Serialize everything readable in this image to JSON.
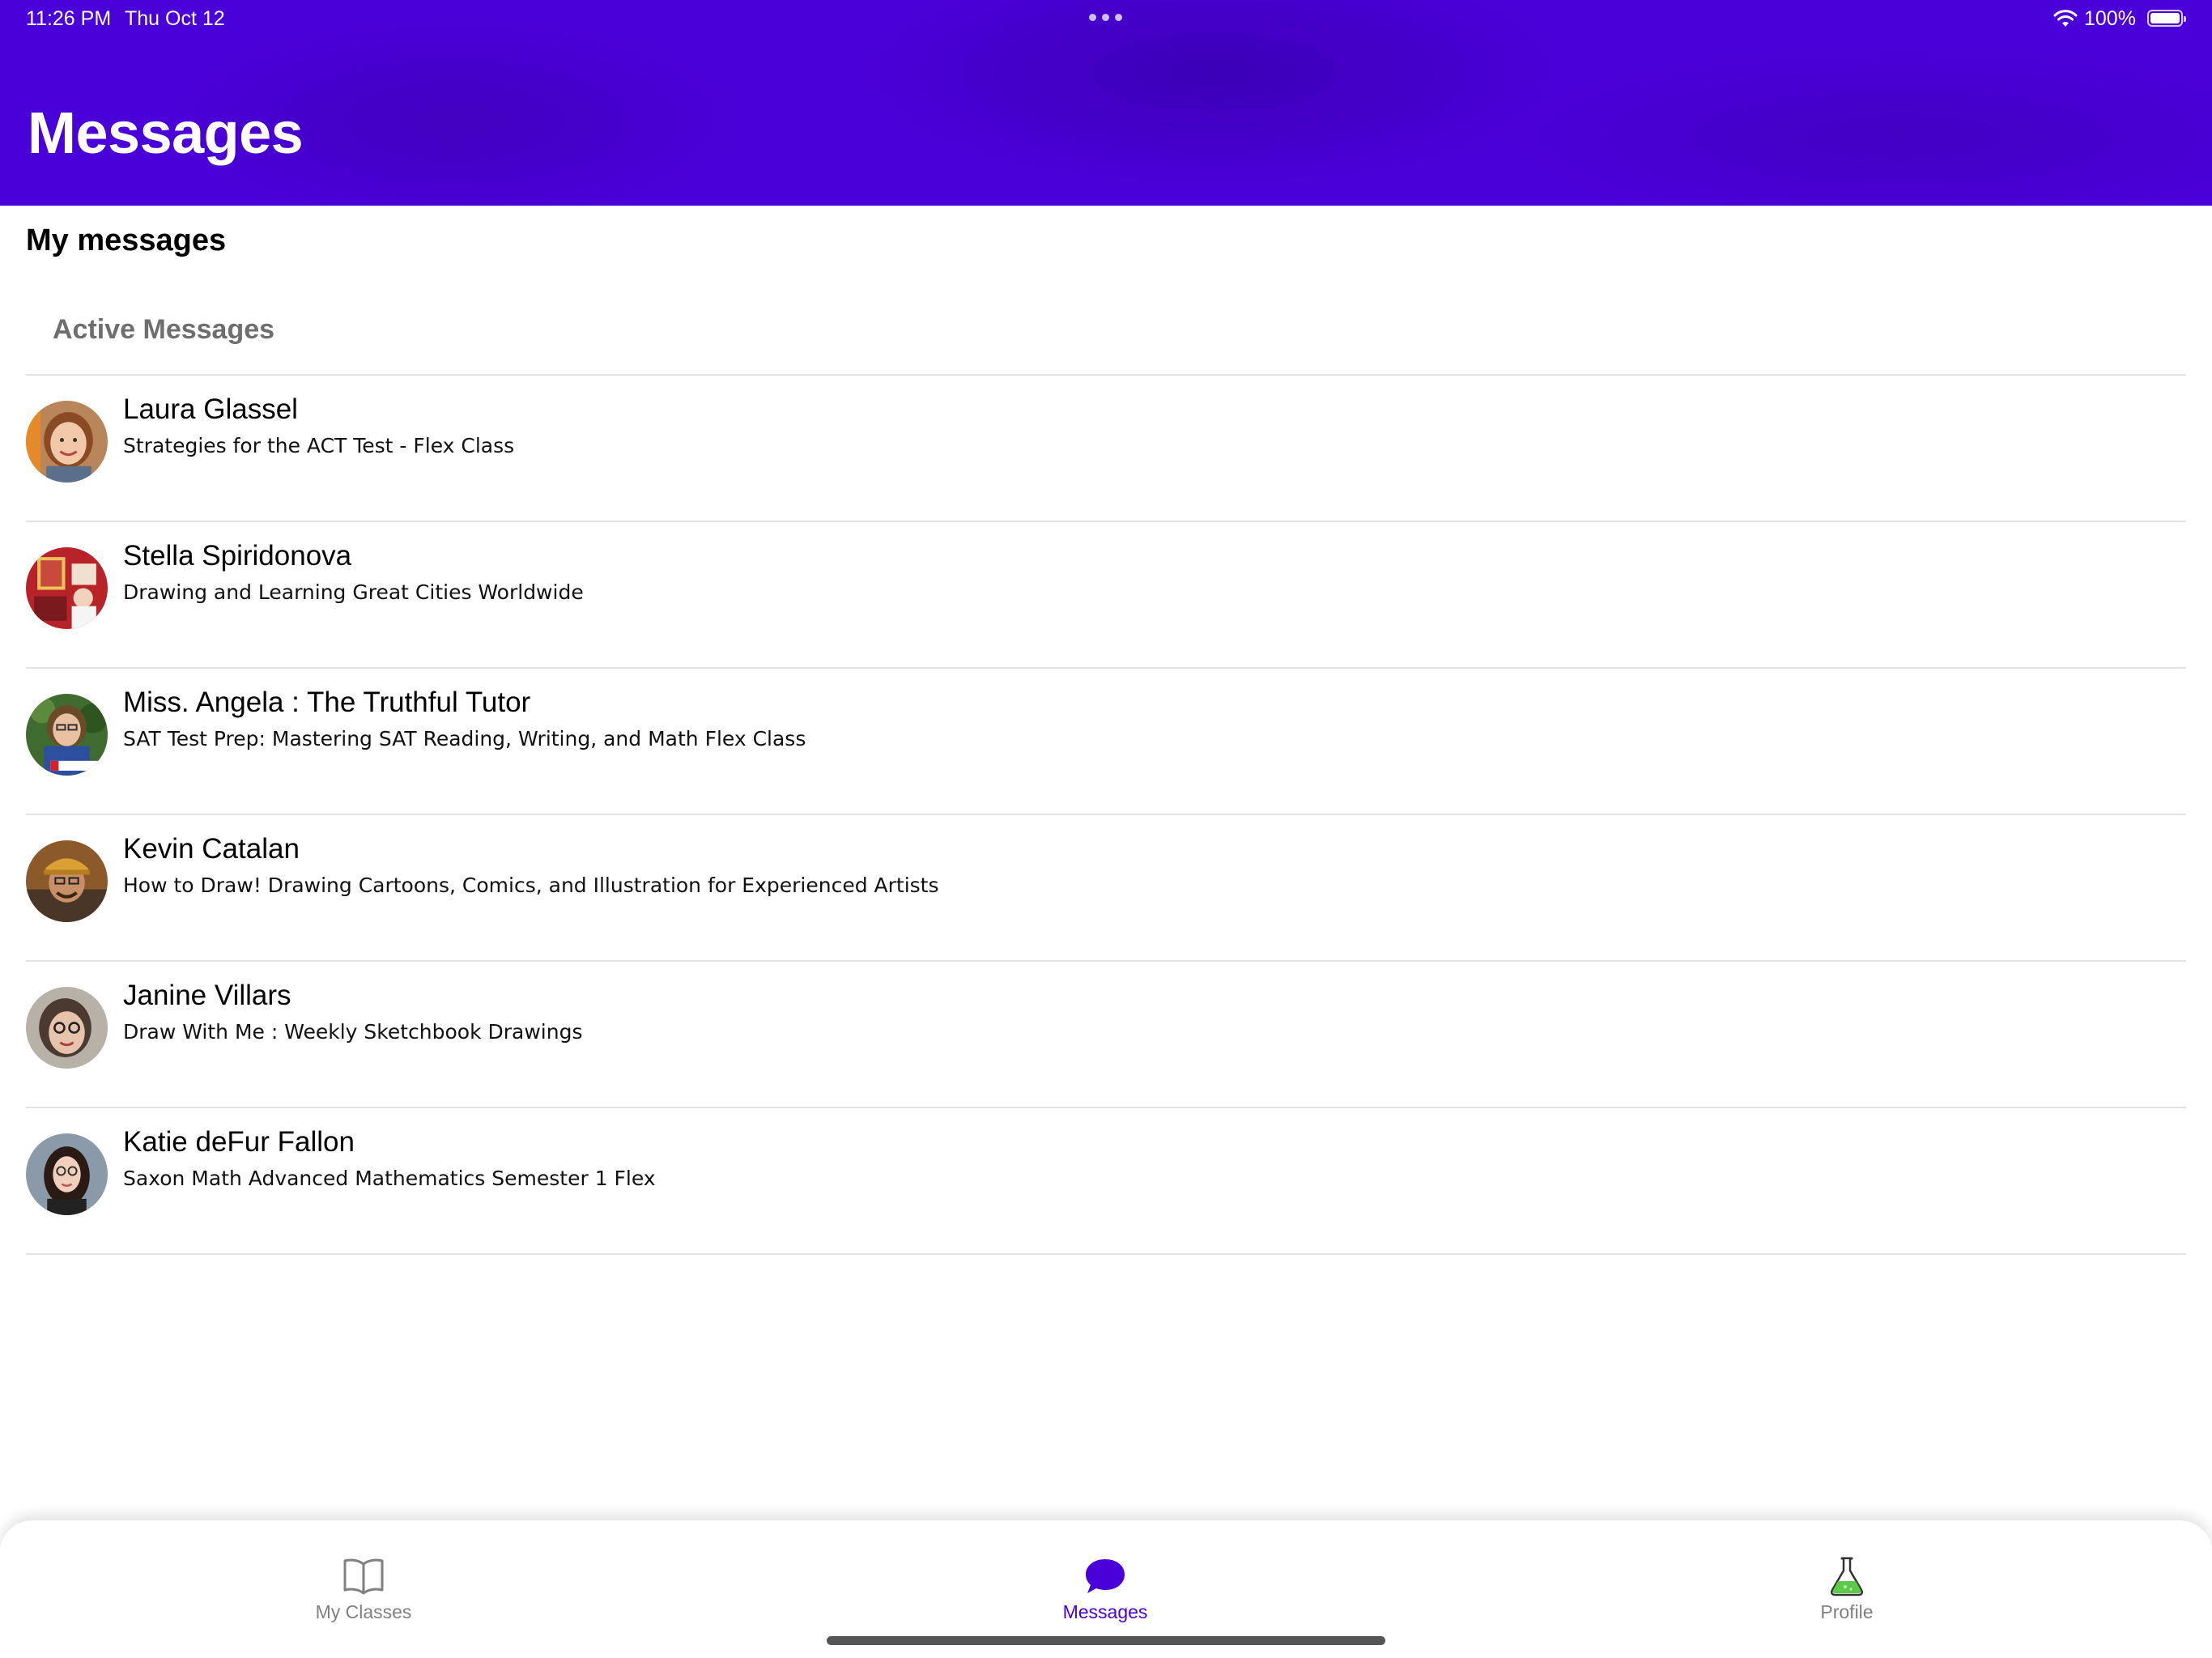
{
  "status_bar": {
    "time": "11:26 PM",
    "date": "Thu Oct 12",
    "battery": "100%"
  },
  "header": {
    "title": "Messages"
  },
  "main": {
    "section_title": "My messages",
    "subsection_title": "Active Messages",
    "messages": [
      {
        "name": "Laura Glassel",
        "class": "Strategies for the ACT Test - Flex Class"
      },
      {
        "name": "Stella Spiridonova",
        "class": "Drawing and Learning Great Cities Worldwide"
      },
      {
        "name": "Miss. Angela : The Truthful Tutor",
        "class": "SAT Test Prep: Mastering SAT Reading, Writing, and Math Flex Class"
      },
      {
        "name": "Kevin Catalan",
        "class": "How to Draw! Drawing Cartoons, Comics, and Illustration for Experienced Artists"
      },
      {
        "name": "Janine Villars",
        "class": "Draw With Me : Weekly Sketchbook Drawings"
      },
      {
        "name": "Katie deFur Fallon",
        "class": "Saxon Math Advanced Mathematics Semester 1 Flex"
      }
    ]
  },
  "tab_bar": {
    "tabs": [
      {
        "label": "My Classes",
        "icon": "book-icon"
      },
      {
        "label": "Messages",
        "icon": "chat-bubble-icon",
        "active": true
      },
      {
        "label": "Profile",
        "icon": "flask-icon"
      }
    ]
  },
  "colors": {
    "brand": "#4a00d8",
    "active_tab": "#4a00d8",
    "inactive_tab": "#808080"
  }
}
